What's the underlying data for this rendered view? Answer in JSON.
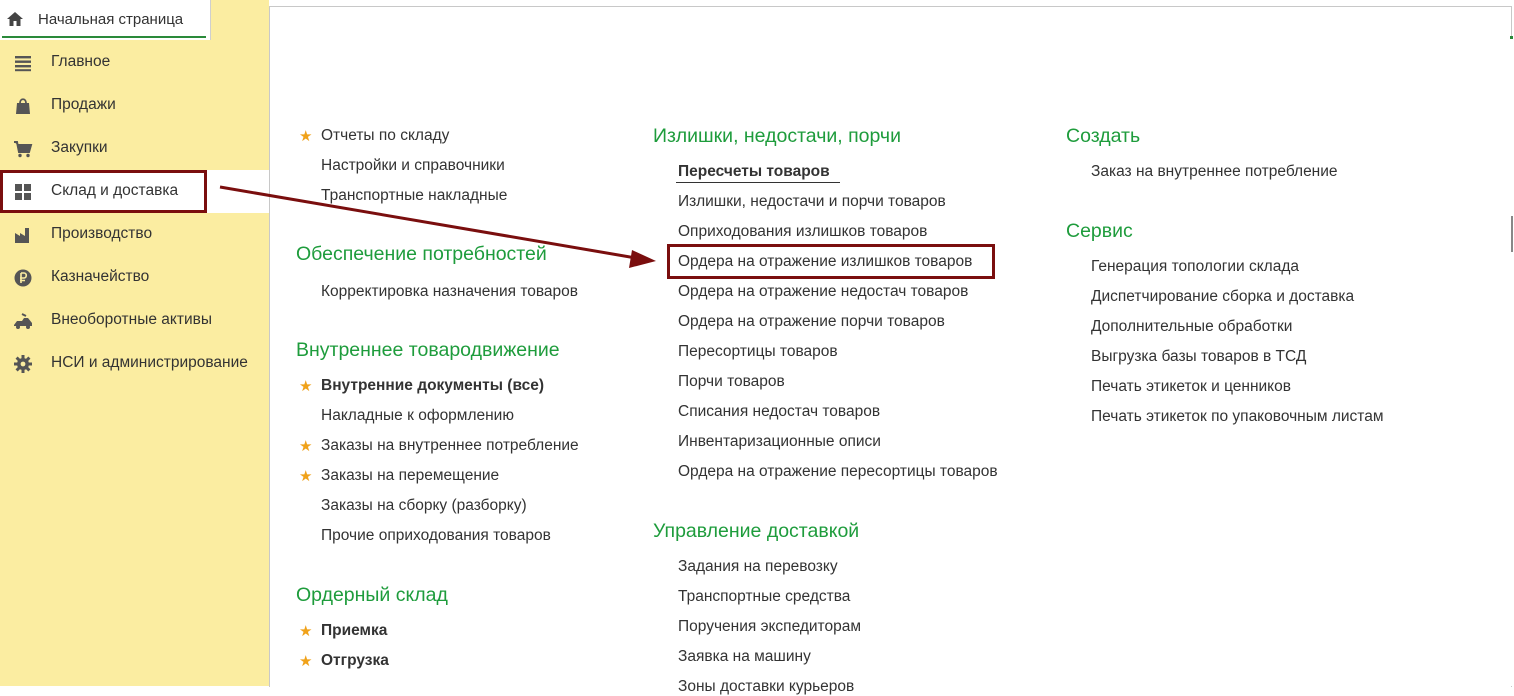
{
  "home_tab": {
    "label": "Начальная страница"
  },
  "sidebar": {
    "items": [
      {
        "label": "Главное",
        "icon": "menu-lines-icon"
      },
      {
        "label": "Продажи",
        "icon": "shopping-bag-icon"
      },
      {
        "label": "Закупки",
        "icon": "shopping-cart-icon"
      },
      {
        "label": "Склад и доставка",
        "icon": "grid-icon",
        "active": true
      },
      {
        "label": "Производство",
        "icon": "factory-icon"
      },
      {
        "label": "Казначейство",
        "icon": "ruble-coin-icon"
      },
      {
        "label": "Внеоборотные активы",
        "icon": "assets-icon"
      },
      {
        "label": "НСИ и администрирование",
        "icon": "gear-icon"
      }
    ]
  },
  "col1": {
    "top_links": [
      {
        "label": "Отчеты по складу",
        "star": true
      },
      {
        "label": "Настройки и справочники",
        "star": false
      },
      {
        "label": "Транспортные накладные",
        "star": false
      }
    ],
    "section_needs": {
      "title": "Обеспечение потребностей",
      "links": [
        {
          "label": "Корректировка назначения товаров"
        }
      ]
    },
    "section_internal": {
      "title": "Внутреннее товародвижение",
      "links": [
        {
          "label": "Внутренние документы (все)",
          "star": true,
          "bold": true
        },
        {
          "label": "Накладные к оформлению",
          "star": false
        },
        {
          "label": "Заказы на внутреннее потребление",
          "star": true
        },
        {
          "label": "Заказы на перемещение",
          "star": true
        },
        {
          "label": "Заказы на сборку (разборку)",
          "star": false
        },
        {
          "label": "Прочие оприходования товаров",
          "star": false
        }
      ]
    },
    "section_order": {
      "title": "Ордерный склад",
      "links": [
        {
          "label": "Приемка",
          "star": true,
          "bold": true
        },
        {
          "label": "Отгрузка",
          "star": true,
          "bold": true
        }
      ]
    }
  },
  "col2": {
    "section_surplus": {
      "title": "Излишки, недостачи, порчи",
      "links": [
        {
          "label": "Пересчеты товаров",
          "bold": true
        },
        {
          "label": "Излишки, недостачи и порчи товаров"
        },
        {
          "label": "Оприходования излишков товаров"
        },
        {
          "label": "Ордера на отражение излишков товаров"
        },
        {
          "label": "Ордера на отражение недостач товаров"
        },
        {
          "label": "Ордера на отражение порчи товаров"
        },
        {
          "label": "Пересортицы товаров"
        },
        {
          "label": "Порчи товаров"
        },
        {
          "label": "Списания недостач товаров"
        },
        {
          "label": "Инвентаризационные описи"
        },
        {
          "label": "Ордера на отражение пересортицы товаров"
        }
      ]
    },
    "section_delivery": {
      "title": "Управление доставкой",
      "links": [
        {
          "label": "Задания на перевозку"
        },
        {
          "label": "Транспортные средства"
        },
        {
          "label": "Поручения экспедиторам"
        },
        {
          "label": "Заявка на машину"
        },
        {
          "label": "Зоны доставки курьеров"
        }
      ]
    }
  },
  "col3": {
    "section_create": {
      "title": "Создать",
      "links": [
        {
          "label": "Заказ на внутреннее потребление"
        }
      ]
    },
    "section_service": {
      "title": "Сервис",
      "links": [
        {
          "label": "Генерация топологии склада"
        },
        {
          "label": "Диспетчирование сборка и доставка"
        },
        {
          "label": "Дополнительные обработки"
        },
        {
          "label": "Выгрузка базы товаров в ТСД"
        },
        {
          "label": "Печать этикеток и ценников"
        },
        {
          "label": "Печать этикеток по упаковочным листам"
        }
      ]
    }
  },
  "colors": {
    "heading": "#1e9c3c",
    "sidebar_bg": "#fbeda1",
    "highlight": "#7a0e0e",
    "star": "#f0a21a"
  }
}
